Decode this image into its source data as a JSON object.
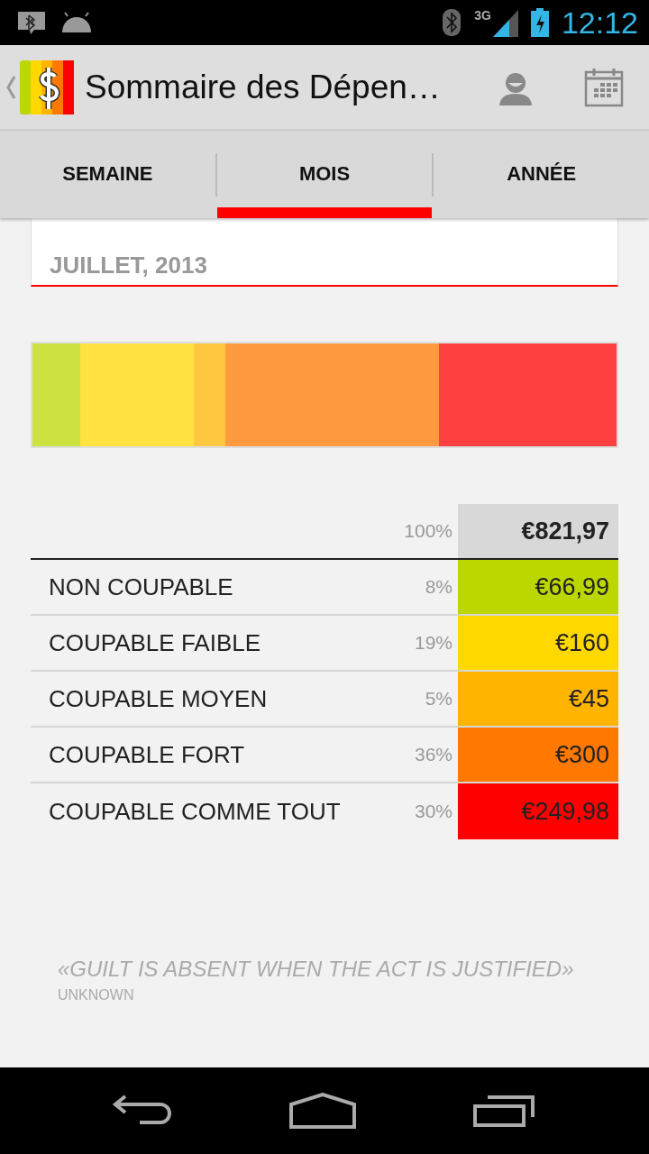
{
  "status_bar": {
    "time": "12:12",
    "network": "3G"
  },
  "action_bar": {
    "title": "Sommaire des Dépen…"
  },
  "tabs": [
    {
      "label": "SEMAINE",
      "selected": false
    },
    {
      "label": "MOIS",
      "selected": true
    },
    {
      "label": "ANNÉE",
      "selected": false
    }
  ],
  "period": "JUILLET, 2013",
  "total": {
    "percent": "100%",
    "amount": "€821,97"
  },
  "categories": [
    {
      "name": "NON COUPABLE",
      "percent": "8%",
      "amount": "€66,99",
      "color": "#bcd700"
    },
    {
      "name": "COUPABLE FAIBLE",
      "percent": "19%",
      "amount": "€160",
      "color": "#ffd800"
    },
    {
      "name": "COUPABLE MOYEN",
      "percent": "5%",
      "amount": "€45",
      "color": "#ffb400"
    },
    {
      "name": "COUPABLE FORT",
      "percent": "36%",
      "amount": "€300",
      "color": "#ff7800"
    },
    {
      "name": "COUPABLE COMME TOUT",
      "percent": "30%",
      "amount": "€249,98",
      "color": "#ff0000"
    }
  ],
  "quote": {
    "text": "«GUILT IS ABSENT WHEN THE ACT IS JUSTIFIED»",
    "author": "UNKNOWN"
  }
}
